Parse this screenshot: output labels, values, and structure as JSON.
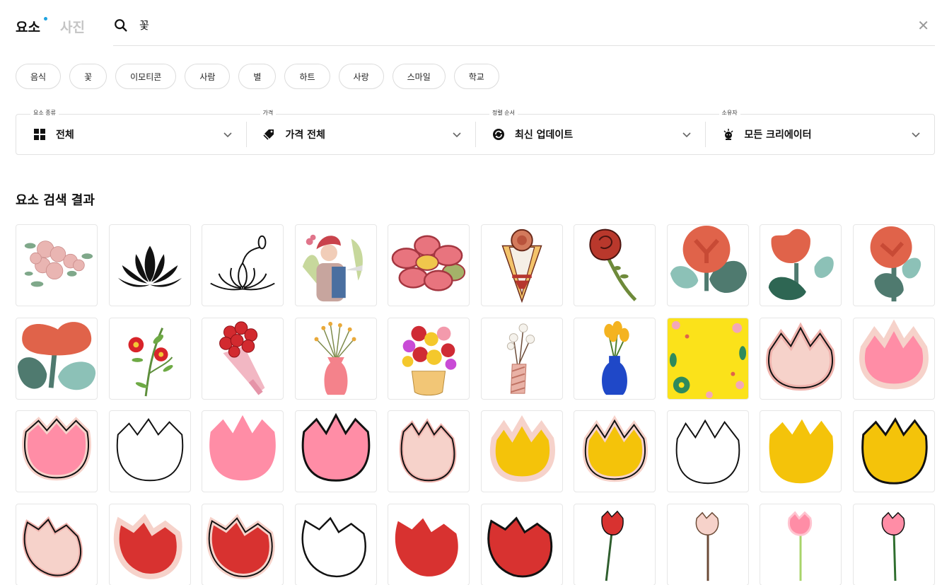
{
  "tabs": [
    {
      "label": "요소",
      "active": true
    },
    {
      "label": "사진",
      "active": false
    }
  ],
  "search": {
    "query": "꽃",
    "clear_icon": "close-icon"
  },
  "chips": [
    "음식",
    "꽃",
    "이모티콘",
    "사람",
    "별",
    "하트",
    "사랑",
    "스마일",
    "학교"
  ],
  "filters": [
    {
      "label": "요소 종류",
      "value": "전체",
      "icon": "grid-icon"
    },
    {
      "label": "가격",
      "value": "가격 전체",
      "icon": "price-tag-icon"
    },
    {
      "label": "정렬 순서",
      "value": "최신 업데이트",
      "icon": "refresh-icon"
    },
    {
      "label": "소유자",
      "value": "모든 크리에이터",
      "icon": "creator-icon"
    }
  ],
  "results": {
    "title": "요소 검색 결과",
    "items": [
      "pink-flower-garland",
      "black-lotus",
      "outline-lotus",
      "woman-watering-plants",
      "pink-flower",
      "rose-bouquet-cone",
      "red-rose",
      "red-flower-teal-leaves",
      "red-tulip-teal-leaves",
      "red-rose-teal-leaves",
      "red-flower-leaves",
      "red-camellia-branch",
      "red-rose-bouquet",
      "vase-dried-flowers",
      "flower-basket",
      "cotton-vase",
      "yellow-tulips-blue-vase",
      "yellow-floral-frame",
      "tulip-peach-outline",
      "tulip-pink-glow",
      "tulip-pink-outline",
      "tulip-white-outline",
      "tulip-pink-plain",
      "tulip-pink-bold",
      "tulip-peach-outline-2",
      "tulip-yellow-glow",
      "tulip-yellow-outline",
      "tulip-white-outline-2",
      "tulip-yellow-plain",
      "tulip-yellow-bold",
      "tulip-peach-tilted",
      "tulip-red-glow",
      "tulip-red-outline",
      "tulip-white-tilted",
      "tulip-red-plain",
      "tulip-red-bold",
      "tulip-stem-red",
      "tulip-stem-peach",
      "tulip-stem-pink-soft",
      "tulip-stem-pink"
    ]
  },
  "colors": {
    "accent_dot": "#1fa3e0",
    "border": "#e2e2e2"
  }
}
